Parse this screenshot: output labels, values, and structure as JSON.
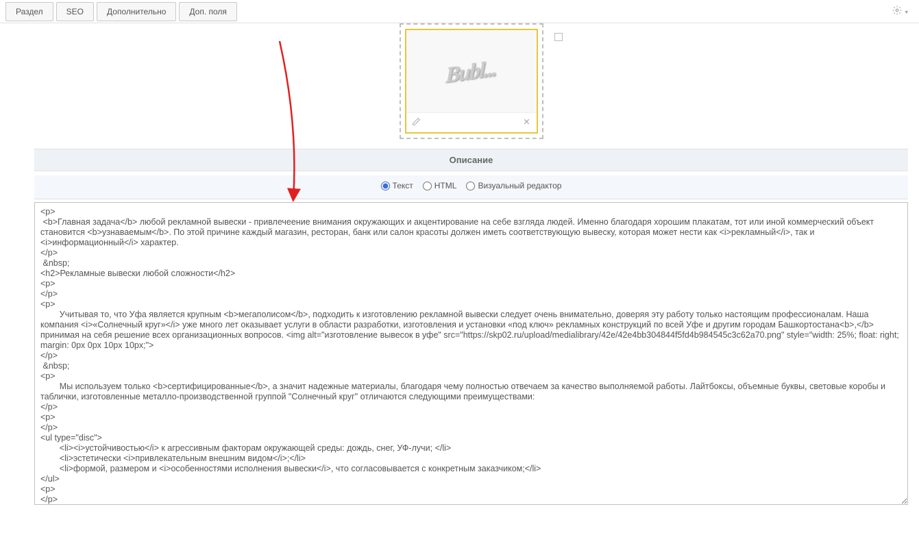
{
  "tabs": {
    "section": "Раздел",
    "seo": "SEO",
    "extra": "Дополнительно",
    "fields": "Доп. поля"
  },
  "imagePreviewPlaceholder": "Bubl...",
  "checkbox": {
    "checked": false
  },
  "sectionTitle": "Описание",
  "radios": {
    "text": "Текст",
    "html": "HTML",
    "visual": "Визуальный редактор",
    "selected": "text"
  },
  "editorContent": "<p>\n <b>Главная задача</b> любой рекламной вывески - привлечеение внимания окружающих и акцентирование на себе взгляда людей. Именно благодаря хорошим плакатам, тот или иной коммерческий объект становится <b>узнаваемым</b>. По этой причине каждый магазин, ресторан, банк или салон красоты должен иметь соответствующую вывеску, которая может нести как <i>рекламный</i>, так и <i>информационный</i> характер.\n</p>\n &nbsp;\n<h2>Рекламные вывески любой сложности</h2>\n<p>\n</p>\n<p>\n\tУчитывая то, что Уфа является крупным <b>мегаполисом</b>, подходить к изготовлению рекламной вывески следует очень внимательно, доверяя эту работу только настоящим профессионалам. Наша компания <i>«Солнечный круг»</i> уже много лет оказывает услуги в области разработки, изготовления и установки «под ключ» рекламных конструкций по всей Уфе и другим городам Башкортостана<b>,</b> принимая на себя решение всех организационных вопросов. <img alt=\"изготовление вывесок в уфе\" src=\"https://skp02.ru/upload/medialibrary/42e/42e4bb304844f5fd4b984545c3c62a70.png\" style=\"width: 25%; float: right; margin: 0px 0px 10px 10px;\">\n</p>\n &nbsp;\n<p>\n\tМы используем только <b>сертифицированные</b>, а значит надежные материалы, благодаря чему полностью отвечаем за качество выполняемой работы. Лайтбоксы, объемные буквы, световые коробы и таблички, изготовленные металло-производственной группой \"Солнечный круг\" отличаются следующими преимуществами:\n</p>\n<p>\n</p>\n<ul type=\"disc\">\n\t<li><i>устойчивостью</i> к агрессивным факторам окружающей среды: дождь, снег, УФ-лучи; </li>\n\t<li>эстетически <i>привлекательным внешним видом</i>;</li>\n\t<li>формой, размером и <i>особенностями исполнения вывески</i>, что согласовывается с конкретным заказчиком;</li>\n</ul>\n<p>\n</p>\n<p>"
}
